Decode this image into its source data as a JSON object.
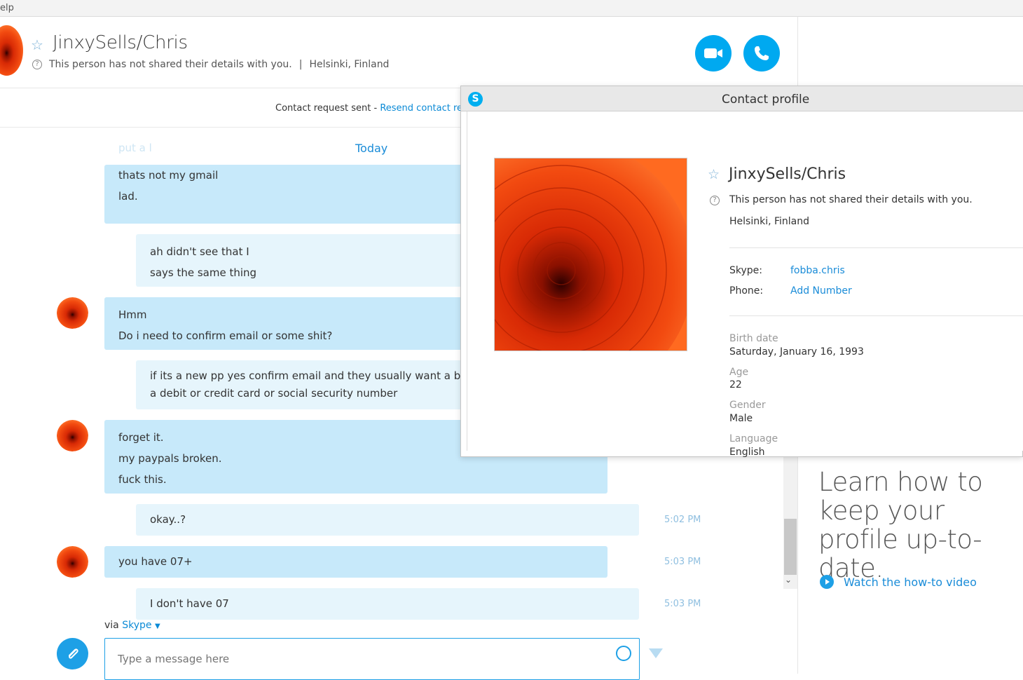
{
  "menu": {
    "help_label": "elp"
  },
  "header": {
    "contact_name": "JinxySells/Chris",
    "not_shared": "This person has not shared their details with you.",
    "separator": "|",
    "location": "Helsinki, Finland"
  },
  "request_bar": {
    "sent_text": "Contact request sent - ",
    "resend_link": "Resend contact re"
  },
  "chat": {
    "day_label": "Today",
    "faded_text": "put a l",
    "messages": [
      {
        "sender": "them",
        "lines": [
          "thats not my gmail",
          "lad."
        ]
      },
      {
        "sender": "me",
        "lines": [
          "ah didn't see that I",
          "says the same thing"
        ]
      },
      {
        "sender": "them",
        "lines": [
          "Hmm",
          "Do i need to confirm email or some shit?"
        ]
      },
      {
        "sender": "me",
        "lines": [
          "if its a new pp yes confirm email and they usually want a banl",
          "a debit or credit card or social security number"
        ]
      },
      {
        "sender": "them",
        "lines": [
          "forget it.",
          "my paypals broken.",
          "fuck this."
        ]
      },
      {
        "sender": "me",
        "lines": [
          "okay..?"
        ],
        "time": "5:02 PM"
      },
      {
        "sender": "them",
        "lines": [
          "you have 07+"
        ],
        "time": "5:03 PM"
      },
      {
        "sender": "me",
        "lines": [
          "I don't have 07"
        ],
        "time": "5:03 PM"
      }
    ]
  },
  "composer": {
    "via_label": "via",
    "via_service": "Skype",
    "placeholder": "Type a message here"
  },
  "right_pane": {
    "learn_title": "Learn how to keep your profile up-to-date.",
    "watch_link": "Watch the how-to video"
  },
  "profile": {
    "window_title": "Contact profile",
    "name": "JinxySells/Chris",
    "not_shared": "This person has not shared their details with you.",
    "location": "Helsinki, Finland",
    "skype_label": "Skype:",
    "skype_value": "fobba.chris",
    "phone_label": "Phone:",
    "phone_value": "Add Number",
    "birth_label": "Birth date",
    "birth_value": "Saturday, January 16, 1993",
    "age_label": "Age",
    "age_value": "22",
    "gender_label": "Gender",
    "gender_value": "Male",
    "language_label": "Language",
    "language_value": "English"
  },
  "colors": {
    "accent": "#00a9f0",
    "bubble_them": "#c7e9fa",
    "bubble_me": "#e6f5fc",
    "link": "#1a8cd8"
  }
}
